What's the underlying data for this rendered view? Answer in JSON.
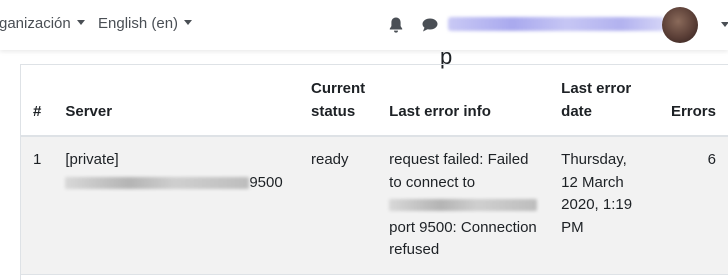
{
  "navbar": {
    "org_menu_label": "ganización",
    "language_label": "English (en)",
    "notifications_icon": "bell-icon",
    "messages_icon": "comment-icon"
  },
  "table": {
    "headers": {
      "index": "#",
      "server": "Server",
      "current_status": "Current status",
      "last_error_info": "Last error info",
      "last_error_date": "Last error date",
      "errors": "Errors"
    },
    "rows": [
      {
        "index": "1",
        "server_name": "[private]",
        "server_url_suffix": "9500",
        "status": "ready",
        "error_prefix": "request failed: Failed to connect to",
        "error_suffix": "port 9500: Connection refused",
        "date": "Thursday, 12 March 2020, 1:19 PM",
        "errors": "6"
      }
    ]
  }
}
